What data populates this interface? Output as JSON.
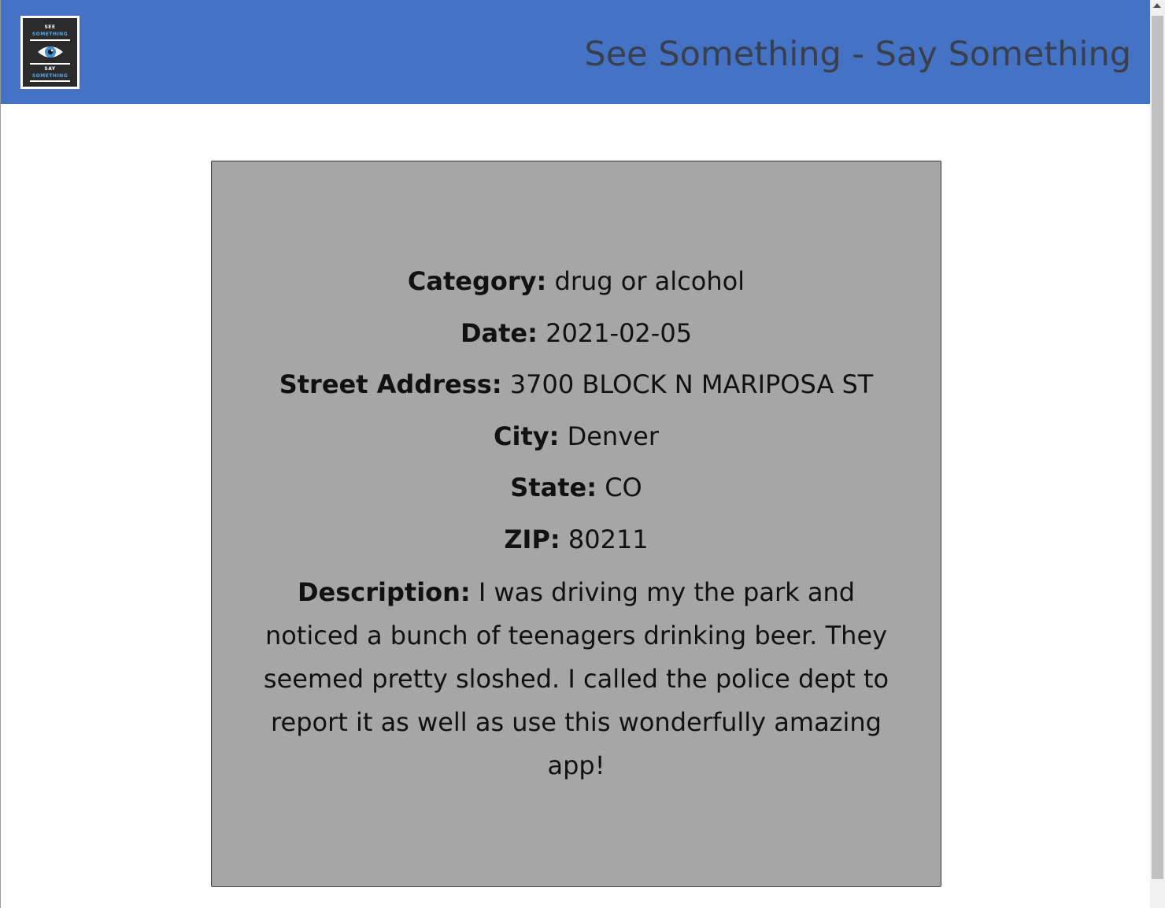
{
  "header": {
    "title": "See Something - Say Something",
    "logo": {
      "line1": "SEE",
      "line2": "SOMETHING",
      "line3": "SAY",
      "line4": "SOMETHING",
      "icon": "eye-icon"
    },
    "colors": {
      "bar": "#4472c4",
      "title": "#3a3f4d"
    }
  },
  "report": {
    "category_label": "Category:",
    "category": "drug or alcohol",
    "date_label": "Date:",
    "date": "2021-02-05",
    "street_label": "Street Address:",
    "street": "3700 BLOCK N MARIPOSA ST",
    "city_label": "City:",
    "city": "Denver",
    "state_label": "State:",
    "state": "CO",
    "zip_label": "ZIP:",
    "zip": "80211",
    "description_label": "Description:",
    "description": "I was driving my the park and noticed a bunch of teenagers drinking beer. They seemed pretty sloshed. I called the police dept to report it as well as use this wonderfully amazing app!",
    "colors": {
      "card_background": "#a6a6a6"
    }
  }
}
